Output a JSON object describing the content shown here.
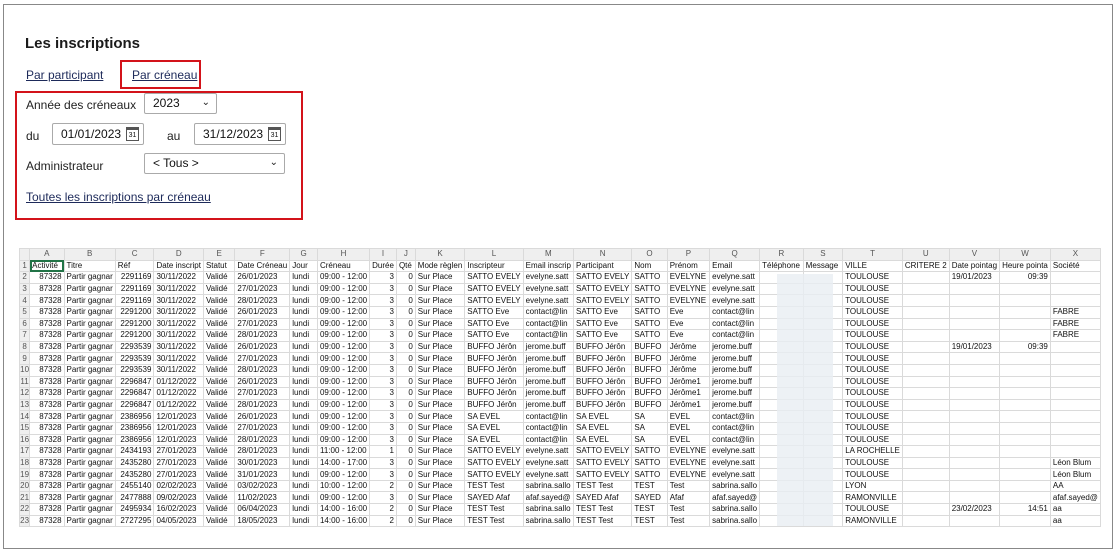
{
  "title": "Les inscriptions",
  "tabs": {
    "participant": "Par participant",
    "creneau": "Par créneau"
  },
  "filters": {
    "annee_label": "Année des créneaux",
    "annee_value": "2023",
    "du_label": "du",
    "du_value": "01/01/2023",
    "au_label": "au",
    "au_value": "31/12/2023",
    "admin_label": "Administrateur",
    "admin_value": "< Tous >",
    "calendar_day": "31",
    "all_link": "Toutes les inscriptions par créneau"
  },
  "spreadsheet": {
    "columns": [
      "A",
      "B",
      "C",
      "D",
      "E",
      "F",
      "G",
      "H",
      "I",
      "J",
      "K",
      "L",
      "M",
      "N",
      "O",
      "P",
      "Q",
      "R",
      "S",
      "T",
      "U",
      "V",
      "W",
      "X"
    ],
    "headers": [
      "Activité",
      "Titre",
      "Réf",
      "Date inscript",
      "Statut",
      "Date Créneau",
      "Jour",
      "Créneau",
      "Durée",
      "Qté",
      "Mode règlen",
      "Inscripteur",
      "Email inscrip",
      "Participant",
      "Nom",
      "Prénom",
      "Email",
      "Téléphone",
      "Message",
      "VILLE",
      "CRITERE 2",
      "Date pointag",
      "Heure pointa",
      "Société"
    ],
    "rows": [
      [
        "87328",
        "Partir gagnar",
        "2291169",
        "30/11/2022",
        "Validé",
        "26/01/2023",
        "lundi",
        "09:00 - 12:00",
        "3",
        "0",
        "Sur Place",
        "SATTO EVELY",
        "evelyne.satt",
        "SATTO EVELY",
        "SATTO",
        "EVELYNE",
        "evelyne.satt",
        "",
        "",
        "TOULOUSE",
        "",
        "19/01/2023",
        "09:39",
        ""
      ],
      [
        "87328",
        "Partir gagnar",
        "2291169",
        "30/11/2022",
        "Validé",
        "27/01/2023",
        "lundi",
        "09:00 - 12:00",
        "3",
        "0",
        "Sur Place",
        "SATTO EVELY",
        "evelyne.satt",
        "SATTO EVELY",
        "SATTO",
        "EVELYNE",
        "evelyne.satt",
        "",
        "",
        "TOULOUSE",
        "",
        "",
        "",
        ""
      ],
      [
        "87328",
        "Partir gagnar",
        "2291169",
        "30/11/2022",
        "Validé",
        "28/01/2023",
        "lundi",
        "09:00 - 12:00",
        "3",
        "0",
        "Sur Place",
        "SATTO EVELY",
        "evelyne.satt",
        "SATTO EVELY",
        "SATTO",
        "EVELYNE",
        "evelyne.satt",
        "",
        "",
        "TOULOUSE",
        "",
        "",
        "",
        ""
      ],
      [
        "87328",
        "Partir gagnar",
        "2291200",
        "30/11/2022",
        "Validé",
        "26/01/2023",
        "lundi",
        "09:00 - 12:00",
        "3",
        "0",
        "Sur Place",
        "SATTO Eve",
        "contact@lin",
        "SATTO Eve",
        "SATTO",
        "Eve",
        "contact@lin",
        "",
        "",
        "TOULOUSE",
        "",
        "",
        "",
        "FABRE"
      ],
      [
        "87328",
        "Partir gagnar",
        "2291200",
        "30/11/2022",
        "Validé",
        "27/01/2023",
        "lundi",
        "09:00 - 12:00",
        "3",
        "0",
        "Sur Place",
        "SATTO Eve",
        "contact@lin",
        "SATTO Eve",
        "SATTO",
        "Eve",
        "contact@lin",
        "",
        "",
        "TOULOUSE",
        "",
        "",
        "",
        "FABRE"
      ],
      [
        "87328",
        "Partir gagnar",
        "2291200",
        "30/11/2022",
        "Validé",
        "28/01/2023",
        "lundi",
        "09:00 - 12:00",
        "3",
        "0",
        "Sur Place",
        "SATTO Eve",
        "contact@lin",
        "SATTO Eve",
        "SATTO",
        "Eve",
        "contact@lin",
        "",
        "",
        "TOULOUSE",
        "",
        "",
        "",
        "FABRE"
      ],
      [
        "87328",
        "Partir gagnar",
        "2293539",
        "30/11/2022",
        "Validé",
        "26/01/2023",
        "lundi",
        "09:00 - 12:00",
        "3",
        "0",
        "Sur Place",
        "BUFFO Jérôn",
        "jerome.buff",
        "BUFFO Jérôn",
        "BUFFO",
        "Jérôme",
        "jerome.buff",
        "",
        "",
        "TOULOUSE",
        "",
        "19/01/2023",
        "09:39",
        ""
      ],
      [
        "87328",
        "Partir gagnar",
        "2293539",
        "30/11/2022",
        "Validé",
        "27/01/2023",
        "lundi",
        "09:00 - 12:00",
        "3",
        "0",
        "Sur Place",
        "BUFFO Jérôn",
        "jerome.buff",
        "BUFFO Jérôn",
        "BUFFO",
        "Jérôme",
        "jerome.buff",
        "",
        "",
        "TOULOUSE",
        "",
        "",
        "",
        ""
      ],
      [
        "87328",
        "Partir gagnar",
        "2293539",
        "30/11/2022",
        "Validé",
        "28/01/2023",
        "lundi",
        "09:00 - 12:00",
        "3",
        "0",
        "Sur Place",
        "BUFFO Jérôn",
        "jerome.buff",
        "BUFFO Jérôn",
        "BUFFO",
        "Jérôme",
        "jerome.buff",
        "",
        "",
        "TOULOUSE",
        "",
        "",
        "",
        ""
      ],
      [
        "87328",
        "Partir gagnar",
        "2296847",
        "01/12/2022",
        "Validé",
        "26/01/2023",
        "lundi",
        "09:00 - 12:00",
        "3",
        "0",
        "Sur Place",
        "BUFFO Jérôn",
        "jerome.buff",
        "BUFFO Jérôn",
        "BUFFO",
        "Jérôme1",
        "jerome.buff",
        "",
        "",
        "TOULOUSE",
        "",
        "",
        "",
        ""
      ],
      [
        "87328",
        "Partir gagnar",
        "2296847",
        "01/12/2022",
        "Validé",
        "27/01/2023",
        "lundi",
        "09:00 - 12:00",
        "3",
        "0",
        "Sur Place",
        "BUFFO Jérôn",
        "jerome.buff",
        "BUFFO Jérôn",
        "BUFFO",
        "Jérôme1",
        "jerome.buff",
        "",
        "",
        "TOULOUSE",
        "",
        "",
        "",
        ""
      ],
      [
        "87328",
        "Partir gagnar",
        "2296847",
        "01/12/2022",
        "Validé",
        "28/01/2023",
        "lundi",
        "09:00 - 12:00",
        "3",
        "0",
        "Sur Place",
        "BUFFO Jérôn",
        "jerome.buff",
        "BUFFO Jérôn",
        "BUFFO",
        "Jérôme1",
        "jerome.buff",
        "",
        "",
        "TOULOUSE",
        "",
        "",
        "",
        ""
      ],
      [
        "87328",
        "Partir gagnar",
        "2386956",
        "12/01/2023",
        "Validé",
        "26/01/2023",
        "lundi",
        "09:00 - 12:00",
        "3",
        "0",
        "Sur Place",
        "SA EVEL",
        "contact@lin",
        "SA EVEL",
        "SA",
        "EVEL",
        "contact@lin",
        "",
        "",
        "TOULOUSE",
        "",
        "",
        "",
        ""
      ],
      [
        "87328",
        "Partir gagnar",
        "2386956",
        "12/01/2023",
        "Validé",
        "27/01/2023",
        "lundi",
        "09:00 - 12:00",
        "3",
        "0",
        "Sur Place",
        "SA EVEL",
        "contact@lin",
        "SA EVEL",
        "SA",
        "EVEL",
        "contact@lin",
        "",
        "",
        "TOULOUSE",
        "",
        "",
        "",
        ""
      ],
      [
        "87328",
        "Partir gagnar",
        "2386956",
        "12/01/2023",
        "Validé",
        "28/01/2023",
        "lundi",
        "09:00 - 12:00",
        "3",
        "0",
        "Sur Place",
        "SA EVEL",
        "contact@lin",
        "SA EVEL",
        "SA",
        "EVEL",
        "contact@lin",
        "",
        "",
        "TOULOUSE",
        "",
        "",
        "",
        ""
      ],
      [
        "87328",
        "Partir gagnar",
        "2434193",
        "27/01/2023",
        "Validé",
        "28/01/2023",
        "lundi",
        "11:00 - 12:00",
        "1",
        "0",
        "Sur Place",
        "SATTO EVELY",
        "evelyne.satt",
        "SATTO EVELY",
        "SATTO",
        "EVELYNE",
        "evelyne.satt",
        "",
        "",
        "LA ROCHELLE",
        "",
        "",
        "",
        ""
      ],
      [
        "87328",
        "Partir gagnar",
        "2435280",
        "27/01/2023",
        "Validé",
        "30/01/2023",
        "lundi",
        "14:00 - 17:00",
        "3",
        "0",
        "Sur Place",
        "SATTO EVELY",
        "evelyne.satt",
        "SATTO EVELY",
        "SATTO",
        "EVELYNE",
        "evelyne.satt",
        "",
        "",
        "TOULOUSE",
        "",
        "",
        "",
        "Léon Blum"
      ],
      [
        "87328",
        "Partir gagnar",
        "2435280",
        "27/01/2023",
        "Validé",
        "31/01/2023",
        "lundi",
        "09:00 - 12:00",
        "3",
        "0",
        "Sur Place",
        "SATTO EVELY",
        "evelyne.satt",
        "SATTO EVELY",
        "SATTO",
        "EVELYNE",
        "evelyne.satt",
        "",
        "",
        "TOULOUSE",
        "",
        "",
        "",
        "Léon Blum"
      ],
      [
        "87328",
        "Partir gagnar",
        "2455140",
        "02/02/2023",
        "Validé",
        "03/02/2023",
        "lundi",
        "10:00 - 12:00",
        "2",
        "0",
        "Sur Place",
        "TEST Test",
        "sabrina.sallo",
        "TEST Test",
        "TEST",
        "Test",
        "sabrina.sallo",
        "",
        "",
        "LYON",
        "",
        "",
        "",
        "AA"
      ],
      [
        "87328",
        "Partir gagnar",
        "2477888",
        "09/02/2023",
        "Validé",
        "11/02/2023",
        "lundi",
        "09:00 - 12:00",
        "3",
        "0",
        "Sur Place",
        "SAYED Afaf",
        "afaf.sayed@",
        "SAYED Afaf",
        "SAYED",
        "Afaf",
        "afaf.sayed@",
        "",
        "",
        "RAMONVILLE",
        "",
        "",
        "",
        "afaf.sayed@"
      ],
      [
        "87328",
        "Partir gagnar",
        "2495934",
        "16/02/2023",
        "Validé",
        "06/04/2023",
        "lundi",
        "14:00 - 16:00",
        "2",
        "0",
        "Sur Place",
        "TEST Test",
        "sabrina.sallo",
        "TEST Test",
        "TEST",
        "Test",
        "sabrina.sallo",
        "",
        "",
        "TOULOUSE",
        "",
        "23/02/2023",
        "14:51",
        "aa"
      ],
      [
        "87328",
        "Partir gagnar",
        "2727295",
        "04/05/2023",
        "Validé",
        "18/05/2023",
        "lundi",
        "14:00 - 16:00",
        "2",
        "0",
        "Sur Place",
        "TEST Test",
        "sabrina.sallo",
        "TEST Test",
        "TEST",
        "Test",
        "sabrina.sallo",
        "",
        "",
        "RAMONVILLE",
        "",
        "",
        "",
        "aa"
      ]
    ]
  }
}
